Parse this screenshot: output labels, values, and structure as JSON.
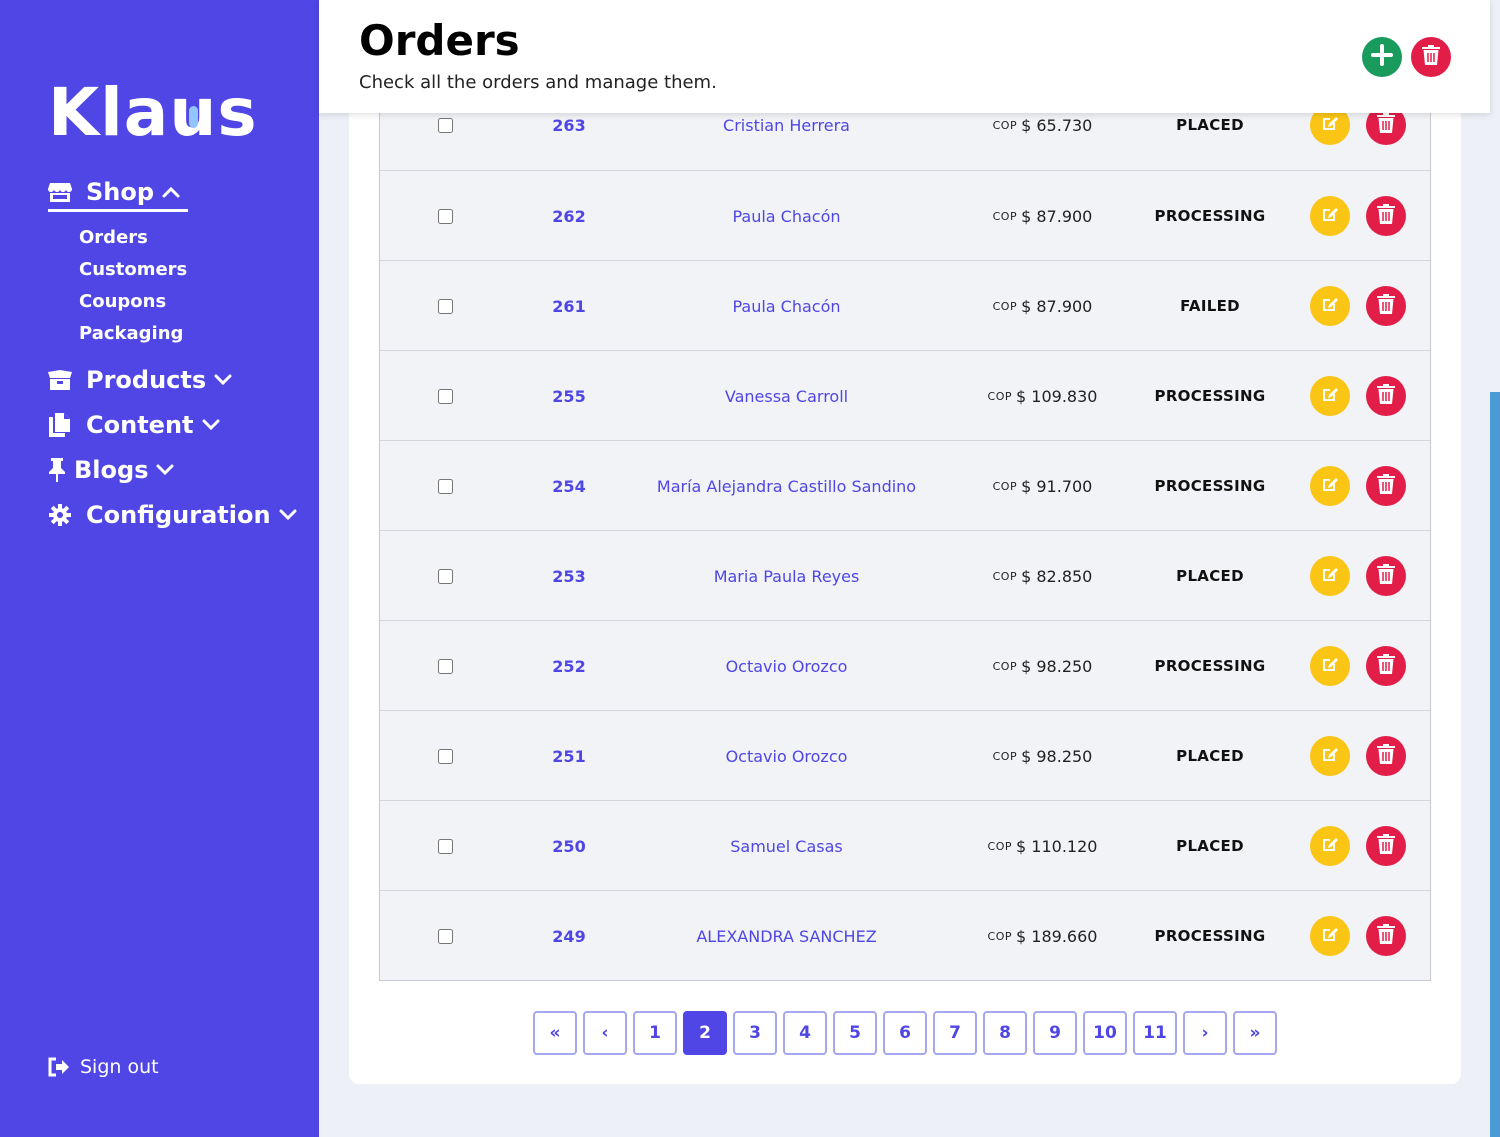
{
  "brand": {
    "logo_text_pre": "Kla",
    "logo_text_u": "u",
    "logo_text_post": "s"
  },
  "header": {
    "title": "Orders",
    "subtitle": "Check all the orders and manage them."
  },
  "sidebar": {
    "sections": [
      {
        "label": "Shop",
        "icon": "store-icon",
        "expanded": true,
        "items": [
          "Orders",
          "Customers",
          "Coupons",
          "Packaging"
        ]
      },
      {
        "label": "Products",
        "icon": "box-icon",
        "expanded": false
      },
      {
        "label": "Content",
        "icon": "copy-icon",
        "expanded": false
      },
      {
        "label": "Blogs",
        "icon": "pin-icon",
        "expanded": false
      },
      {
        "label": "Configuration",
        "icon": "gear-icon",
        "expanded": false
      }
    ],
    "signout": "Sign out"
  },
  "orders": [
    {
      "id": "263",
      "customer": "Cristian Herrera",
      "currency": "COP",
      "amount": "$ 65.730",
      "status": "PLACED"
    },
    {
      "id": "262",
      "customer": "Paula Chacón",
      "currency": "COP",
      "amount": "$ 87.900",
      "status": "PROCESSING"
    },
    {
      "id": "261",
      "customer": "Paula Chacón",
      "currency": "COP",
      "amount": "$ 87.900",
      "status": "FAILED"
    },
    {
      "id": "255",
      "customer": "Vanessa Carroll",
      "currency": "COP",
      "amount": "$ 109.830",
      "status": "PROCESSING"
    },
    {
      "id": "254",
      "customer": "María Alejandra Castillo Sandino",
      "currency": "COP",
      "amount": "$ 91.700",
      "status": "PROCESSING"
    },
    {
      "id": "253",
      "customer": "Maria Paula Reyes",
      "currency": "COP",
      "amount": "$ 82.850",
      "status": "PLACED"
    },
    {
      "id": "252",
      "customer": "Octavio Orozco",
      "currency": "COP",
      "amount": "$ 98.250",
      "status": "PROCESSING"
    },
    {
      "id": "251",
      "customer": "Octavio Orozco",
      "currency": "COP",
      "amount": "$ 98.250",
      "status": "PLACED"
    },
    {
      "id": "250",
      "customer": "Samuel Casas",
      "currency": "COP",
      "amount": "$ 110.120",
      "status": "PLACED"
    },
    {
      "id": "249",
      "customer": "ALEXANDRA SANCHEZ",
      "currency": "COP",
      "amount": "$ 189.660",
      "status": "PROCESSING"
    }
  ],
  "pagination": {
    "first": "«",
    "prev": "‹",
    "next": "›",
    "last": "»",
    "pages": [
      "1",
      "2",
      "3",
      "4",
      "5",
      "6",
      "7",
      "8",
      "9",
      "10",
      "11"
    ],
    "current": "2"
  },
  "colors": {
    "brand": "#4f46e5",
    "edit": "#fac515",
    "delete": "#e11d48",
    "add": "#1a9b5e"
  }
}
